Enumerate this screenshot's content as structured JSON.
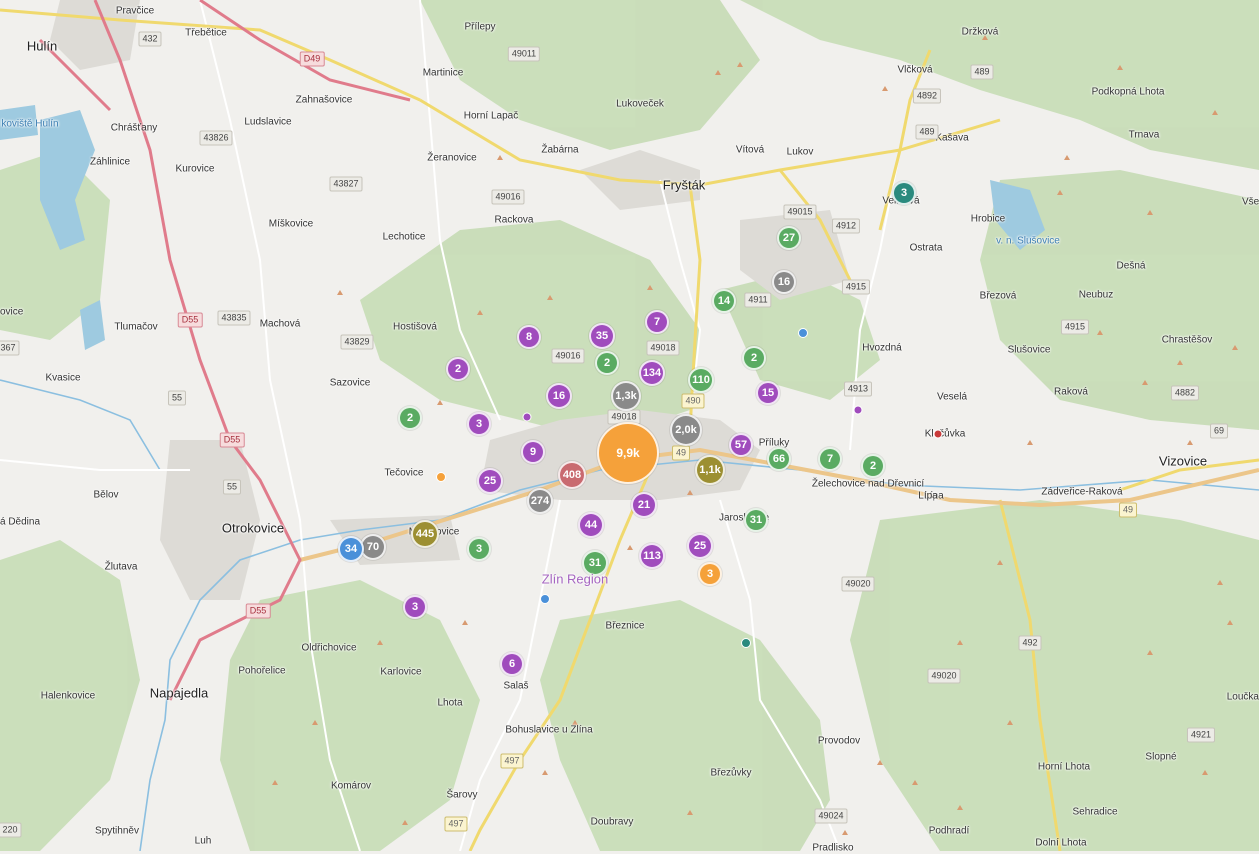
{
  "map": {
    "colors": {
      "forest": "#c6dcb5",
      "water": "#9cc9df",
      "urban": "#dcdad5",
      "motorway": "#e07b8b",
      "primary": "#f4e28a",
      "peak": "#d89a70"
    },
    "region_label": "Zlín Region",
    "water_labels": [
      "koviště Hulín",
      "v. n. Slušovice"
    ],
    "places": [
      "Pravčice",
      "Hulín",
      "Třebětice",
      "Přílepy",
      "Držková",
      "Vlčková",
      "Podkopná Lhota",
      "Martinice",
      "Zahnašovice",
      "Chrášťany",
      "Ludslavice",
      "Horní Lapač",
      "Lukoveček",
      "Kašava",
      "Trnava",
      "Záhlinice",
      "Kurovice",
      "Žeranovice",
      "Žabárna",
      "Vítová",
      "Lukov",
      "Fryšták",
      "Veliková",
      "Hrobice",
      "Všemina",
      "Rackova",
      "Míškovice",
      "Lechotice",
      "Ostrata",
      "Dešná",
      "Tlumačov",
      "Machová",
      "Hostišová",
      "Březová",
      "Neubuz",
      "Slušovice",
      "Chrastěšov",
      "ovice",
      "Kvasice",
      "Sazovice",
      "Hvozdná",
      "Raková",
      "Veselá",
      "Lípa",
      "Klečůvka",
      "Vizovice",
      "Tečovice",
      "Želechovice nad Dřevnicí",
      "Zádveřice-Raková",
      "Bělov",
      "Otrokovice",
      "Příluky",
      "Jaroslavice",
      "á Dědina",
      "Malenovice",
      "Žlutava",
      "Lípa",
      "Březnice",
      "Oldřichovice",
      "Pohořelice",
      "Karlovice",
      "Halenkovice",
      "Napajedla",
      "Salaš",
      "Lhota",
      "Bohuslavice u Zlína",
      "Provodov",
      "Loučka",
      "Horní Lhota",
      "Slopné",
      "Komárov",
      "Březůvky",
      "Šarovy",
      "Sehradice",
      "Spytihněv",
      "Doubravy",
      "Podhradí",
      "Dolní Lhota",
      "Pradlisko",
      "Zlín",
      "Luh"
    ],
    "road_numbers": [
      "432",
      "D49",
      "49011",
      "489",
      "4892",
      "489",
      "43826",
      "43827",
      "49016",
      "49015",
      "4912",
      "4911",
      "4915",
      "4915",
      "D55",
      "43835",
      "43829",
      "49016",
      "49018",
      "490",
      "49018",
      "4913",
      "4882",
      "367",
      "55",
      "D55",
      "55",
      "49",
      "69",
      "49",
      "D55",
      "49020",
      "492",
      "49020",
      "4921",
      "497",
      "497",
      "49024",
      "220"
    ],
    "clusters": [
      {
        "label": "9,9k",
        "color": "#f5a13a"
      },
      {
        "label": "2,0k",
        "color": "#8a8a8a"
      },
      {
        "label": "1,3k",
        "color": "#8a8a8a"
      },
      {
        "label": "1,1k",
        "color": "#9c8f32"
      },
      {
        "label": "445",
        "color": "#9c8f32"
      },
      {
        "label": "408",
        "color": "#c96a70"
      },
      {
        "label": "274",
        "color": "#8a8a8a"
      },
      {
        "label": "134",
        "color": "#a04cbd"
      },
      {
        "label": "113",
        "color": "#a04cbd"
      },
      {
        "label": "110",
        "color": "#5aab62"
      },
      {
        "label": "70",
        "color": "#8a8a8a"
      },
      {
        "label": "66",
        "color": "#5aab62"
      },
      {
        "label": "57",
        "color": "#a04cbd"
      },
      {
        "label": "44",
        "color": "#a04cbd"
      },
      {
        "label": "35",
        "color": "#a04cbd"
      },
      {
        "label": "34",
        "color": "#4a90d9"
      },
      {
        "label": "31",
        "color": "#5aab62"
      },
      {
        "label": "31",
        "color": "#5aab62"
      },
      {
        "label": "27",
        "color": "#5aab62"
      },
      {
        "label": "25",
        "color": "#a04cbd"
      },
      {
        "label": "25",
        "color": "#a04cbd"
      },
      {
        "label": "21",
        "color": "#a04cbd"
      },
      {
        "label": "16",
        "color": "#a04cbd"
      },
      {
        "label": "16",
        "color": "#8a8a8a"
      },
      {
        "label": "15",
        "color": "#a04cbd"
      },
      {
        "label": "14",
        "color": "#5aab62"
      },
      {
        "label": "9",
        "color": "#a04cbd"
      },
      {
        "label": "8",
        "color": "#a04cbd"
      },
      {
        "label": "7",
        "color": "#a04cbd"
      },
      {
        "label": "7",
        "color": "#5aab62"
      },
      {
        "label": "6",
        "color": "#a04cbd"
      },
      {
        "label": "3",
        "color": "#a04cbd"
      },
      {
        "label": "3",
        "color": "#a04cbd"
      },
      {
        "label": "3",
        "color": "#5aab62"
      },
      {
        "label": "3",
        "color": "#f5a13a"
      },
      {
        "label": "3",
        "color": "#2a8a7e"
      },
      {
        "label": "2",
        "color": "#a04cbd"
      },
      {
        "label": "2",
        "color": "#5aab62"
      },
      {
        "label": "2",
        "color": "#5aab62"
      },
      {
        "label": "2",
        "color": "#5aab62"
      },
      {
        "label": "2",
        "color": "#5aab62"
      }
    ],
    "single_points": [
      {
        "color": "#4a90d9"
      },
      {
        "color": "#4a90d9"
      },
      {
        "color": "#f5a13a"
      },
      {
        "color": "#a04cbd"
      },
      {
        "color": "#a04cbd"
      },
      {
        "color": "#c93b3b"
      },
      {
        "color": "#2a8a7e"
      }
    ]
  }
}
